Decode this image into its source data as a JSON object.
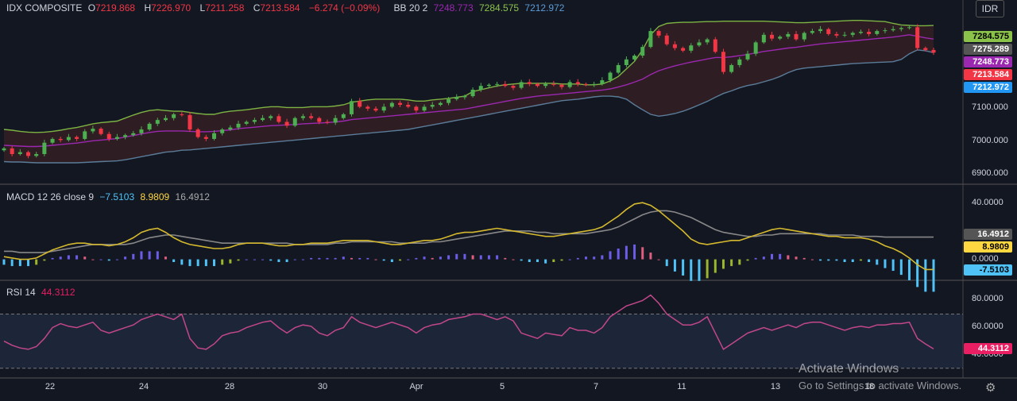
{
  "header": {
    "symbol": "IDX COMPOSITE",
    "o_label": "O",
    "o_value": "7219.868",
    "h_label": "H",
    "h_value": "7226.970",
    "l_label": "L",
    "l_value": "7211.258",
    "c_label": "C",
    "c_value": "7213.584",
    "change": "−6.274 (−0.09%)",
    "bb_label": "BB 20 2",
    "bb_basis": "7248.773",
    "bb_upper": "7284.575",
    "bb_lower": "7212.972",
    "currency": "IDR"
  },
  "macd_legend": {
    "label": "MACD 12 26 close 9",
    "macd": "−7.5103",
    "signal": "8.9809",
    "hist": "16.4912"
  },
  "rsi_legend": {
    "label": "RSI 14",
    "value": "44.3112"
  },
  "price_axis": {
    "ticks": [
      "7100.000",
      "7000.000",
      "6900.000"
    ]
  },
  "price_badges": {
    "upper": "7284.575",
    "last_close": "7275.289",
    "basis": "7248.773",
    "close": "7213.584",
    "lower": "7212.972"
  },
  "macd_axis": {
    "ticks": [
      "40.0000",
      "0.0000"
    ],
    "badge_hist": "16.4912",
    "badge_signal": "8.9809",
    "badge_macd": "-7.5103"
  },
  "rsi_axis": {
    "ticks": [
      "80.0000",
      "60.0000",
      "40.0000"
    ],
    "badge": "44.3112"
  },
  "x_axis": {
    "ticks": [
      "22",
      "24",
      "28",
      "30",
      "Apr",
      "5",
      "7",
      "11",
      "13",
      "18"
    ]
  },
  "watermark": {
    "line1": "Activate Windows",
    "line2": "Go to Settings to activate Windows."
  },
  "colors": {
    "up": "#4caf50",
    "down": "#f23645",
    "basis": "#9c27b0",
    "upper": "#7cb342",
    "lower": "#5b7c99",
    "macd": "#d4b82e",
    "signal": "#888888",
    "rsi": "#c2478a"
  },
  "chart_data": [
    {
      "type": "candlestick",
      "title": "IDX COMPOSITE",
      "ylim": [
        6880,
        7310
      ],
      "closes": [
        6960,
        6945,
        6950,
        6940,
        6945,
        6975,
        6985,
        6982,
        6990,
        6985,
        7005,
        7012,
        6998,
        6985,
        6990,
        6995,
        7000,
        7010,
        7025,
        7035,
        7040,
        7050,
        7048,
        7010,
        6990,
        6985,
        7000,
        7010,
        7015,
        7025,
        7030,
        7035,
        7040,
        7045,
        7030,
        7020,
        7040,
        7045,
        7040,
        7030,
        7028,
        7040,
        7050,
        7085,
        7070,
        7065,
        7060,
        7070,
        7080,
        7075,
        7070,
        7060,
        7070,
        7075,
        7080,
        7090,
        7095,
        7098,
        7115,
        7125,
        7128,
        7130,
        7125,
        7120,
        7135,
        7130,
        7125,
        7130,
        7128,
        7122,
        7135,
        7130,
        7128,
        7130,
        7140,
        7160,
        7180,
        7195,
        7205,
        7228,
        7270,
        7258,
        7235,
        7225,
        7218,
        7232,
        7240,
        7248,
        7215,
        7162,
        7180,
        7195,
        7210,
        7240,
        7260,
        7250,
        7255,
        7262,
        7248,
        7265,
        7270,
        7275,
        7262,
        7258,
        7260,
        7265,
        7268,
        7262,
        7270,
        7272,
        7275,
        7278,
        7280,
        7225,
        7220,
        7213
      ],
      "bb_upper": [
        7010,
        7008,
        7005,
        7003,
        7002,
        7003,
        7005,
        7008,
        7012,
        7015,
        7020,
        7025,
        7028,
        7030,
        7032,
        7040,
        7048,
        7055,
        7060,
        7062,
        7060,
        7058,
        7058,
        7055,
        7052,
        7050,
        7050,
        7055,
        7058,
        7060,
        7062,
        7065,
        7068,
        7070,
        7070,
        7068,
        7068,
        7068,
        7070,
        7070,
        7070,
        7072,
        7075,
        7082,
        7085,
        7088,
        7090,
        7090,
        7090,
        7090,
        7088,
        7085,
        7085,
        7088,
        7090,
        7092,
        7095,
        7098,
        7110,
        7115,
        7120,
        7125,
        7128,
        7130,
        7132,
        7132,
        7132,
        7132,
        7132,
        7130,
        7130,
        7130,
        7128,
        7128,
        7130,
        7138,
        7150,
        7170,
        7190,
        7220,
        7260,
        7282,
        7290,
        7292,
        7293,
        7293,
        7294,
        7295,
        7295,
        7296,
        7296,
        7296,
        7296,
        7296,
        7296,
        7295,
        7294,
        7293,
        7292,
        7292,
        7293,
        7294,
        7295,
        7296,
        7297,
        7298,
        7298,
        7297,
        7296,
        7295,
        7290,
        7286,
        7285,
        7284,
        7284,
        7284.575
      ],
      "bb_basis": [
        6968,
        6967,
        6966,
        6965,
        6965,
        6966,
        6968,
        6970,
        6972,
        6974,
        6977,
        6980,
        6982,
        6984,
        6986,
        6990,
        6994,
        6998,
        7002,
        7005,
        7006,
        7006,
        7006,
        7005,
        7004,
        7004,
        7005,
        7007,
        7009,
        7012,
        7014,
        7016,
        7018,
        7020,
        7021,
        7022,
        7023,
        7025,
        7026,
        7027,
        7028,
        7030,
        7032,
        7036,
        7038,
        7040,
        7042,
        7044,
        7046,
        7048,
        7050,
        7052,
        7054,
        7056,
        7058,
        7060,
        7062,
        7064,
        7068,
        7072,
        7076,
        7080,
        7084,
        7088,
        7092,
        7095,
        7098,
        7100,
        7102,
        7104,
        7106,
        7108,
        7110,
        7112,
        7114,
        7117,
        7122,
        7128,
        7135,
        7143,
        7155,
        7165,
        7172,
        7178,
        7183,
        7188,
        7192,
        7196,
        7200,
        7200,
        7202,
        7205,
        7208,
        7212,
        7216,
        7219,
        7222,
        7225,
        7227,
        7230,
        7233,
        7236,
        7238,
        7240,
        7242,
        7244,
        7246,
        7248,
        7250,
        7252,
        7254,
        7257,
        7260,
        7256,
        7252,
        7248.773
      ],
      "bb_lower": [
        6925,
        6924,
        6924,
        6923,
        6922,
        6922,
        6922,
        6922,
        6922,
        6922,
        6923,
        6924,
        6925,
        6926,
        6927,
        6930,
        6934,
        6938,
        6942,
        6946,
        6950,
        6952,
        6955,
        6956,
        6958,
        6960,
        6962,
        6964,
        6966,
        6968,
        6970,
        6972,
        6974,
        6976,
        6978,
        6980,
        6982,
        6984,
        6986,
        6988,
        6990,
        6992,
        6994,
        6996,
        6998,
        7000,
        7002,
        7004,
        7006,
        7008,
        7010,
        7014,
        7018,
        7022,
        7026,
        7030,
        7034,
        7038,
        7042,
        7046,
        7050,
        7054,
        7058,
        7062,
        7066,
        7070,
        7074,
        7078,
        7082,
        7086,
        7088,
        7090,
        7093,
        7096,
        7098,
        7098,
        7096,
        7090,
        7075,
        7062,
        7050,
        7045,
        7048,
        7052,
        7058,
        7066,
        7075,
        7084,
        7095,
        7105,
        7112,
        7120,
        7126,
        7130,
        7136,
        7142,
        7150,
        7160,
        7168,
        7172,
        7174,
        7176,
        7178,
        7180,
        7182,
        7184,
        7185,
        7186,
        7187,
        7188,
        7189,
        7195,
        7210,
        7220,
        7218,
        7212.972
      ]
    },
    {
      "type": "line",
      "title": "MACD 12 26 close 9",
      "ylim": [
        -12,
        48
      ],
      "series": [
        {
          "name": "MACD",
          "values": [
            2,
            1,
            0,
            0,
            1,
            4,
            7,
            9,
            11,
            12,
            12,
            11,
            11,
            10,
            11,
            13,
            16,
            20,
            22,
            23,
            20,
            16,
            13,
            11,
            10,
            9,
            8,
            8,
            9,
            11,
            12,
            12,
            12,
            11,
            10,
            10,
            11,
            11,
            12,
            12,
            12,
            13,
            14,
            14,
            14,
            14,
            13,
            12,
            11,
            11,
            12,
            13,
            14,
            14,
            15,
            17,
            19,
            20,
            20,
            21,
            22,
            23,
            22,
            21,
            20,
            19,
            18,
            17,
            17,
            18,
            19,
            20,
            21,
            22,
            24,
            28,
            32,
            37,
            41,
            42,
            40,
            36,
            31,
            26,
            21,
            15,
            12,
            11,
            12,
            13,
            14,
            14,
            16,
            18,
            20,
            22,
            23,
            22,
            21,
            20,
            19,
            18,
            17,
            17,
            16,
            16,
            16,
            15,
            13,
            10,
            8,
            5,
            1,
            -4,
            -7.5103,
            -7.5103
          ]
        },
        {
          "name": "Signal",
          "values": [
            6,
            6,
            5,
            5,
            5,
            5,
            6,
            7,
            8,
            9,
            10,
            11,
            11,
            11,
            11,
            11,
            12,
            14,
            16,
            17,
            18,
            18,
            17,
            16,
            15,
            14,
            13,
            12,
            12,
            12,
            12,
            12,
            12,
            12,
            12,
            12,
            11,
            11,
            11,
            11,
            11,
            12,
            12,
            13,
            13,
            13,
            13,
            13,
            13,
            12,
            12,
            12,
            12,
            13,
            13,
            14,
            15,
            16,
            17,
            18,
            19,
            20,
            21,
            21,
            21,
            21,
            20,
            20,
            19,
            19,
            19,
            19,
            19,
            20,
            21,
            22,
            24,
            27,
            30,
            33,
            35,
            36,
            36,
            35,
            33,
            31,
            28,
            25,
            22,
            20,
            19,
            18,
            17,
            17,
            18,
            18,
            19,
            19,
            19,
            19,
            19,
            19,
            18,
            18,
            18,
            18,
            17,
            17,
            17,
            16.4912,
            16.4912,
            16.4912,
            16.4912,
            16.4912,
            16.4912,
            16.4912
          ]
        }
      ]
    },
    {
      "type": "line",
      "title": "RSI 14",
      "ylim": [
        24,
        92
      ],
      "series": [
        {
          "name": "RSI",
          "values": [
            50,
            47,
            45,
            44,
            46,
            52,
            60,
            63,
            61,
            60,
            62,
            64,
            58,
            56,
            58,
            60,
            62,
            66,
            68,
            70,
            68,
            66,
            70,
            52,
            45,
            44,
            48,
            54,
            56,
            57,
            60,
            62,
            64,
            65,
            60,
            56,
            60,
            62,
            61,
            56,
            54,
            58,
            60,
            68,
            64,
            62,
            60,
            62,
            64,
            62,
            60,
            56,
            60,
            62,
            63,
            66,
            67,
            68,
            70,
            70,
            68,
            66,
            68,
            65,
            56,
            54,
            52,
            56,
            55,
            54,
            60,
            58,
            58,
            56,
            60,
            68,
            72,
            76,
            78,
            80,
            84,
            78,
            70,
            66,
            62,
            62,
            64,
            68,
            56,
            44,
            48,
            52,
            56,
            58,
            60,
            58,
            60,
            62,
            60,
            63,
            64,
            64,
            62,
            60,
            58,
            60,
            61,
            60,
            62,
            62,
            63,
            63,
            64,
            52,
            48,
            44.3112
          ]
        }
      ]
    }
  ]
}
